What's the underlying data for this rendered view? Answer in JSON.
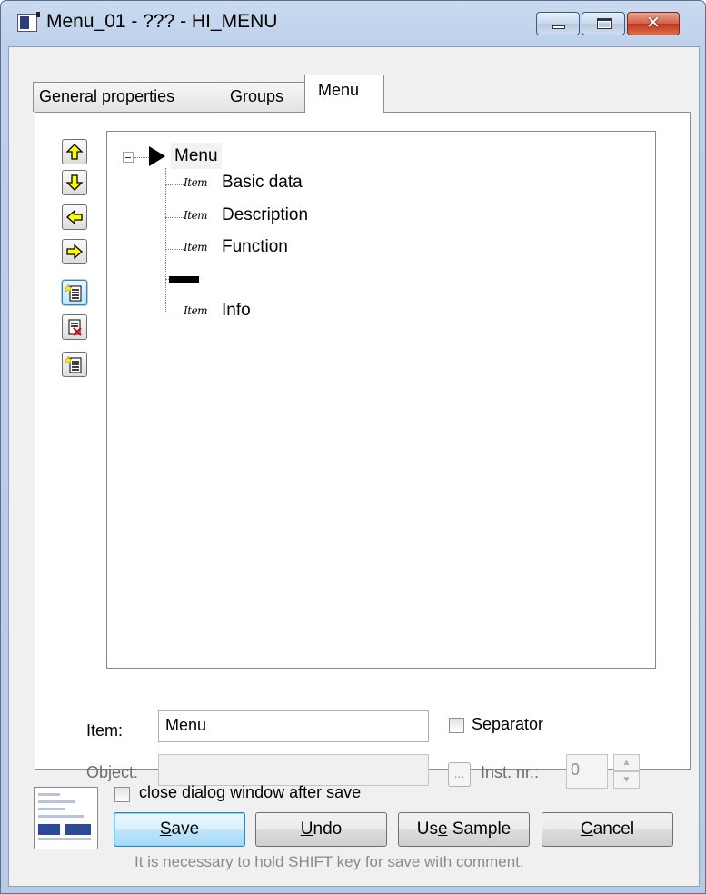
{
  "window": {
    "title": "Menu_01 - ??? - HI_MENU",
    "caption_buttons": {
      "minimize": "minimize",
      "maximize": "maximize",
      "close": "close"
    }
  },
  "tabs": [
    {
      "label": "General properties",
      "selected": false
    },
    {
      "label": "Groups",
      "selected": false
    },
    {
      "label": "Menu",
      "selected": true
    }
  ],
  "toolbar": {
    "icons": [
      "move-up-arrow-icon",
      "move-down-arrow-icon",
      "move-left-arrow-icon",
      "move-right-arrow-icon",
      "new-item-icon",
      "delete-item-icon",
      "new-subitem-icon"
    ]
  },
  "tree": {
    "root": {
      "label": "Menu",
      "expanded": true
    },
    "item_icon_text": "Item",
    "children": [
      {
        "label": "Basic data",
        "type": "item"
      },
      {
        "label": "Description",
        "type": "item"
      },
      {
        "label": "Function",
        "type": "item"
      },
      {
        "label": "",
        "type": "separator"
      },
      {
        "label": "Info",
        "type": "item"
      }
    ]
  },
  "form": {
    "item_label": "Item:",
    "item_value": "Menu",
    "separator_label": "Separator",
    "separator_checked": false,
    "object_label": "Object:",
    "object_value": "",
    "object_button": "...",
    "inst_label": "Inst. nr.:",
    "inst_value": "0"
  },
  "footer": {
    "close_after_save_label": "close dialog window after save",
    "close_after_save_checked": false,
    "buttons": {
      "save": {
        "pre": "",
        "key": "S",
        "post": "ave"
      },
      "undo": {
        "pre": "",
        "key": "U",
        "post": "ndo"
      },
      "use_sample": {
        "pre": "Us",
        "key": "e",
        "post": " Sample"
      },
      "cancel": {
        "pre": "",
        "key": "C",
        "post": "ancel"
      }
    },
    "hint": "It is necessary to hold SHIFT key for save with comment."
  },
  "colors": {
    "arrow_fill": "#ffff00",
    "selection_blue": "#bee6fd",
    "disabled_text": "#8a8a8a"
  }
}
